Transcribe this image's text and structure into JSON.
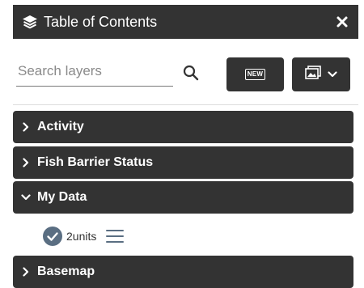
{
  "panel": {
    "title": "Table of Contents",
    "icon": "layers-icon",
    "close_icon": "close-icon"
  },
  "toolbar": {
    "search_placeholder": "Search layers",
    "search_value": "",
    "new_label": "NEW",
    "basemap_icon": "image-icon",
    "basemap_dropdown_icon": "chevron-down-icon"
  },
  "sections": [
    {
      "label": "Activity",
      "expanded": false
    },
    {
      "label": "Fish Barrier Status",
      "expanded": false
    },
    {
      "label": "My Data",
      "expanded": true
    },
    {
      "label": "Basemap",
      "expanded": false
    }
  ],
  "my_data_layers": [
    {
      "name": "2units",
      "checked": true
    }
  ],
  "colors": {
    "header_bg": "#333333",
    "checkbox_fill": "#5a6e82",
    "text_on_dark": "#ffffff"
  }
}
